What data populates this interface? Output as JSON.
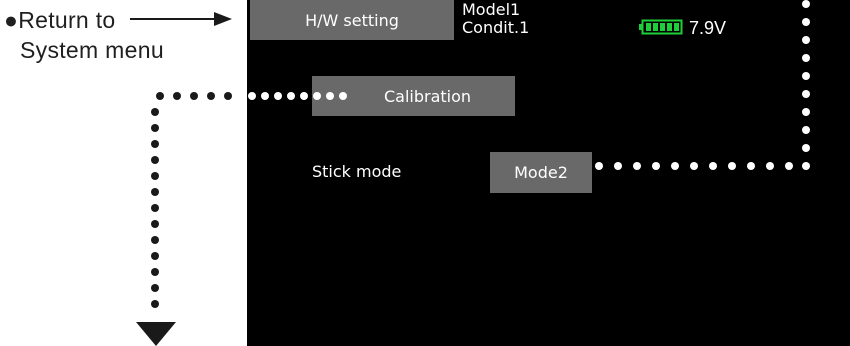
{
  "annotations": {
    "return_line1": "●Return to",
    "return_line2": "System menu"
  },
  "screen": {
    "hw_setting_button": "H/W setting",
    "model_name": "Model1",
    "condition_name": "Condit.1",
    "battery_voltage": "7.9V",
    "calibration_button": "Calibration",
    "stick_mode_label": "Stick mode",
    "stick_mode_value": "Mode2"
  },
  "colors": {
    "screen_bg": "#000000",
    "button_bg": "#696969",
    "battery_green": "#1fcf3a"
  }
}
